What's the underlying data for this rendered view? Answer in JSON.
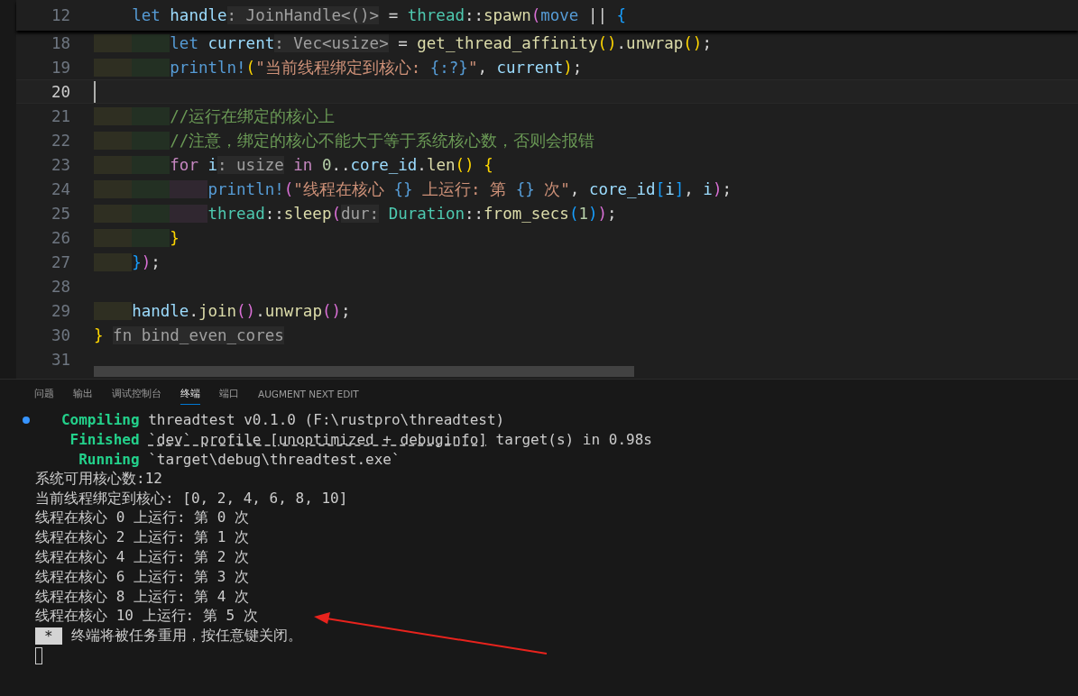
{
  "editor": {
    "sticky_line": {
      "number": "12",
      "tokens": [
        {
          "t": "    let",
          "kind": "kw"
        },
        {
          "t": " handle",
          "kind": "var"
        },
        {
          "t": ": JoinHandle<()>",
          "kind": "hint"
        },
        {
          "t": " = ",
          "kind": "p"
        },
        {
          "t": "thread",
          "kind": "type"
        },
        {
          "t": "::",
          "kind": "p"
        },
        {
          "t": "spawn",
          "kind": "fn"
        },
        {
          "t": "(",
          "kind": "b2"
        },
        {
          "t": "move",
          "kind": "kw"
        },
        {
          "t": " || ",
          "kind": "p"
        },
        {
          "t": "{",
          "kind": "b3"
        }
      ]
    },
    "lines": [
      {
        "number": "18",
        "current": false,
        "tokens": [
          {
            "t": "        let",
            "kind": "kw"
          },
          {
            "t": " current",
            "kind": "var"
          },
          {
            "t": ": Vec<usize>",
            "kind": "hint"
          },
          {
            "t": " = ",
            "kind": "p"
          },
          {
            "t": "get_thread_affinity",
            "kind": "fn"
          },
          {
            "t": "()",
            "kind": "b1"
          },
          {
            "t": ".",
            "kind": "p"
          },
          {
            "t": "unwrap",
            "kind": "fn"
          },
          {
            "t": "()",
            "kind": "b1"
          },
          {
            "t": ";",
            "kind": "p"
          }
        ]
      },
      {
        "number": "19",
        "current": false,
        "tokens": [
          {
            "t": "        println!",
            "kind": "kw"
          },
          {
            "t": "(",
            "kind": "b1"
          },
          {
            "t": "\"当前线程绑定到核心: ",
            "kind": "str"
          },
          {
            "t": "{:?}",
            "kind": "kw"
          },
          {
            "t": "\"",
            "kind": "str"
          },
          {
            "t": ", ",
            "kind": "p"
          },
          {
            "t": "current",
            "kind": "var"
          },
          {
            "t": ")",
            "kind": "b1"
          },
          {
            "t": ";",
            "kind": "p"
          }
        ]
      },
      {
        "number": "20",
        "current": true
      },
      {
        "number": "21",
        "current": false,
        "tokens": [
          {
            "t": "        //运行在绑定的核心上",
            "kind": "cm"
          }
        ]
      },
      {
        "number": "22",
        "current": false,
        "tokens": [
          {
            "t": "        //注意，绑定的核心不能大于等于系统核心数，否则会报错",
            "kind": "cm"
          }
        ]
      },
      {
        "number": "23",
        "current": false,
        "tokens": [
          {
            "t": "        for",
            "kind": "ctrl"
          },
          {
            "t": " i",
            "kind": "var"
          },
          {
            "t": ": usize",
            "kind": "hint"
          },
          {
            "t": " in",
            "kind": "ctrl"
          },
          {
            "t": " 0",
            "kind": "num"
          },
          {
            "t": "..",
            "kind": "p"
          },
          {
            "t": "core_id",
            "kind": "var"
          },
          {
            "t": ".",
            "kind": "p"
          },
          {
            "t": "len",
            "kind": "fn"
          },
          {
            "t": "()",
            "kind": "b1"
          },
          {
            "t": " {",
            "kind": "b1"
          }
        ]
      },
      {
        "number": "24",
        "current": false,
        "tokens": [
          {
            "t": "            println!",
            "kind": "kw"
          },
          {
            "t": "(",
            "kind": "b2"
          },
          {
            "t": "\"线程在核心 ",
            "kind": "str"
          },
          {
            "t": "{}",
            "kind": "kw"
          },
          {
            "t": " 上运行: 第 ",
            "kind": "str"
          },
          {
            "t": "{}",
            "kind": "kw"
          },
          {
            "t": " 次\"",
            "kind": "str"
          },
          {
            "t": ", ",
            "kind": "p"
          },
          {
            "t": "core_id",
            "kind": "var"
          },
          {
            "t": "[",
            "kind": "b3"
          },
          {
            "t": "i",
            "kind": "var"
          },
          {
            "t": "]",
            "kind": "b3"
          },
          {
            "t": ", ",
            "kind": "p"
          },
          {
            "t": "i",
            "kind": "var"
          },
          {
            "t": ")",
            "kind": "b2"
          },
          {
            "t": ";",
            "kind": "p"
          }
        ]
      },
      {
        "number": "25",
        "current": false,
        "tokens": [
          {
            "t": "            thread",
            "kind": "type"
          },
          {
            "t": "::",
            "kind": "p"
          },
          {
            "t": "sleep",
            "kind": "fn"
          },
          {
            "t": "(",
            "kind": "b2"
          },
          {
            "t": "dur:",
            "kind": "hint"
          },
          {
            "t": " Duration",
            "kind": "type"
          },
          {
            "t": "::",
            "kind": "p"
          },
          {
            "t": "from_secs",
            "kind": "fn"
          },
          {
            "t": "(",
            "kind": "b3"
          },
          {
            "t": "1",
            "kind": "num"
          },
          {
            "t": ")",
            "kind": "b3"
          },
          {
            "t": ")",
            "kind": "b2"
          },
          {
            "t": ";",
            "kind": "p"
          }
        ]
      },
      {
        "number": "26",
        "current": false,
        "tokens": [
          {
            "t": "        }",
            "kind": "b1"
          }
        ]
      },
      {
        "number": "27",
        "current": false,
        "tokens": [
          {
            "t": "    }",
            "kind": "b3"
          },
          {
            "t": ")",
            "kind": "b2"
          },
          {
            "t": ";",
            "kind": "p"
          }
        ]
      },
      {
        "number": "28",
        "current": false
      },
      {
        "number": "29",
        "current": false,
        "tokens": [
          {
            "t": "    handle",
            "kind": "var"
          },
          {
            "t": ".",
            "kind": "p"
          },
          {
            "t": "join",
            "kind": "fn"
          },
          {
            "t": "()",
            "kind": "b2"
          },
          {
            "t": ".",
            "kind": "p"
          },
          {
            "t": "unwrap",
            "kind": "fn"
          },
          {
            "t": "()",
            "kind": "b2"
          },
          {
            "t": ";",
            "kind": "p"
          }
        ]
      },
      {
        "number": "30",
        "current": false,
        "tokens": [
          {
            "t": "}",
            "kind": "b1"
          },
          {
            "t": " fn bind_even_cores",
            "kind": "hint"
          }
        ]
      },
      {
        "number": "31",
        "current": false
      }
    ]
  },
  "panel": {
    "tabs": [
      {
        "label": "问题",
        "selected": false
      },
      {
        "label": "输出",
        "selected": false
      },
      {
        "label": "调试控制台",
        "selected": false
      },
      {
        "label": "终端",
        "selected": true
      },
      {
        "label": "端口",
        "selected": false
      },
      {
        "label": "AUGMENT NEXT EDIT",
        "selected": false
      }
    ],
    "terminal": [
      {
        "kind": "cargo",
        "status_dot": true,
        "label": "Compiling",
        "text": "threadtest v0.1.0 (F:\\rustpro\\threadtest)"
      },
      {
        "kind": "cargo",
        "status_dot": false,
        "label": "Finished",
        "link": "`dev` profile [unoptimized + debuginfo]",
        "text": "target(s) in 0.98s"
      },
      {
        "kind": "cargo",
        "status_dot": false,
        "label": "Running",
        "text": "`target\\debug\\threadtest.exe`"
      },
      {
        "kind": "plain",
        "text": "系统可用核心数:12"
      },
      {
        "kind": "plain",
        "text": "当前线程绑定到核心: [0, 2, 4, 6, 8, 10]"
      },
      {
        "kind": "plain",
        "text": "线程在核心 0 上运行: 第 0 次"
      },
      {
        "kind": "plain",
        "text": "线程在核心 2 上运行: 第 1 次"
      },
      {
        "kind": "plain",
        "text": "线程在核心 4 上运行: 第 2 次"
      },
      {
        "kind": "plain",
        "text": "线程在核心 6 上运行: 第 3 次"
      },
      {
        "kind": "plain",
        "text": "线程在核心 8 上运行: 第 4 次"
      },
      {
        "kind": "plain",
        "text": "线程在核心 10 上运行: 第 5 次"
      },
      {
        "kind": "notice",
        "badge": "*",
        "text": "终端将被任务重用，按任意键关闭。"
      },
      {
        "kind": "cursor"
      }
    ]
  }
}
